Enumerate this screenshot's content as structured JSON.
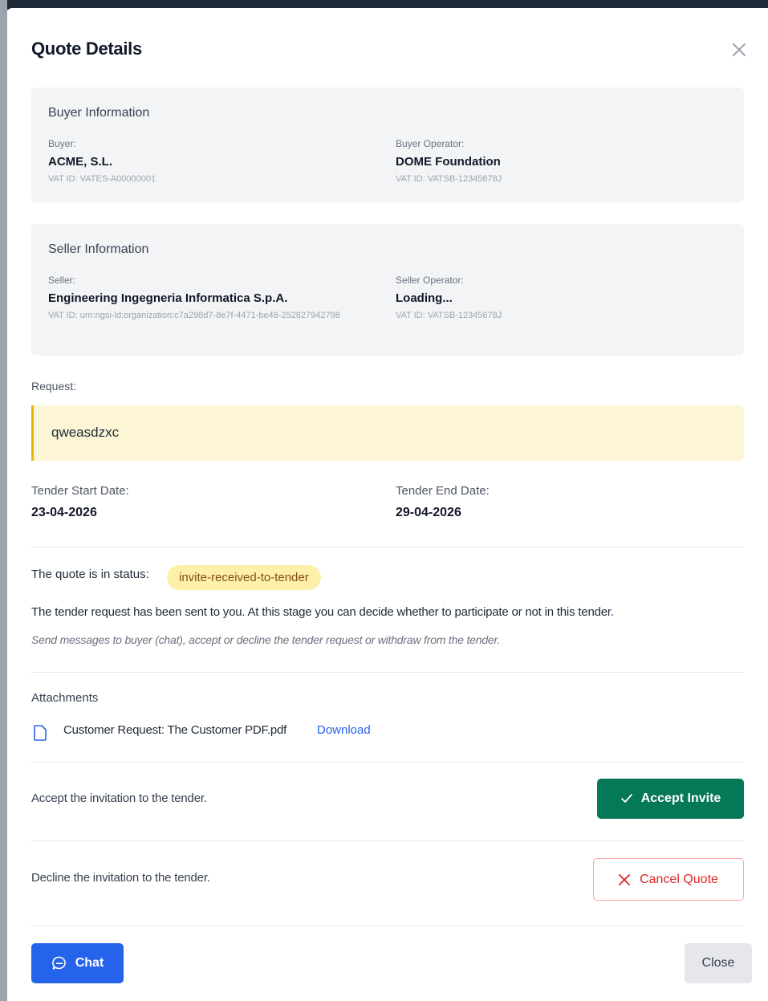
{
  "modal": {
    "title": "Quote Details"
  },
  "buyer": {
    "heading": "Buyer Information",
    "buyer_label": "Buyer:",
    "buyer_name": "ACME, S.L.",
    "buyer_vat": "VAT ID: VATES-A00000001",
    "operator_label": "Buyer Operator:",
    "operator_name": "DOME Foundation",
    "operator_vat": "VAT ID: VATSB-12345678J"
  },
  "seller": {
    "heading": "Seller Information",
    "seller_label": "Seller:",
    "seller_name": "Engineering Ingegneria Informatica S.p.A.",
    "seller_vat": "VAT ID: urn:ngsi-ld:organization:c7a298d7-8e7f-4471-be48-252827942798",
    "operator_label": "Seller Operator:",
    "operator_name": "Loading...",
    "operator_vat": "VAT ID: VATSB-12345678J"
  },
  "request": {
    "label": "Request:",
    "text": "qweasdzxc"
  },
  "dates": {
    "start_label": "Tender Start Date:",
    "start_value": "23-04-2026",
    "end_label": "Tender End Date:",
    "end_value": "29-04-2026"
  },
  "status": {
    "prefix": "The quote is in status:",
    "badge": "invite-received-to-tender",
    "badge_color": "#fdf0a8",
    "description": "The tender request has been sent to you. At this stage you can decide whether to participate or not in this tender.",
    "hint": "Send messages to buyer (chat), accept or decline the tender request or withdraw from the tender."
  },
  "attachments": {
    "heading": "Attachments",
    "file_icon": "file-icon",
    "file_name": "Customer Request: The Customer PDF.pdf",
    "download_label": "Download"
  },
  "actions": {
    "accept_text": "Accept the invitation to the tender.",
    "accept_label": "Accept Invite",
    "accept_icon": "check-icon",
    "accept_color": "#047857",
    "decline_text": "Decline the invitation to the tender.",
    "cancel_label": "Cancel Quote",
    "cancel_icon": "x-icon",
    "cancel_color": "#dc2626"
  },
  "footer": {
    "chat_label": "Chat",
    "chat_icon": "chat-bubble-icon",
    "chat_color": "#2563eb",
    "close_label": "Close"
  }
}
